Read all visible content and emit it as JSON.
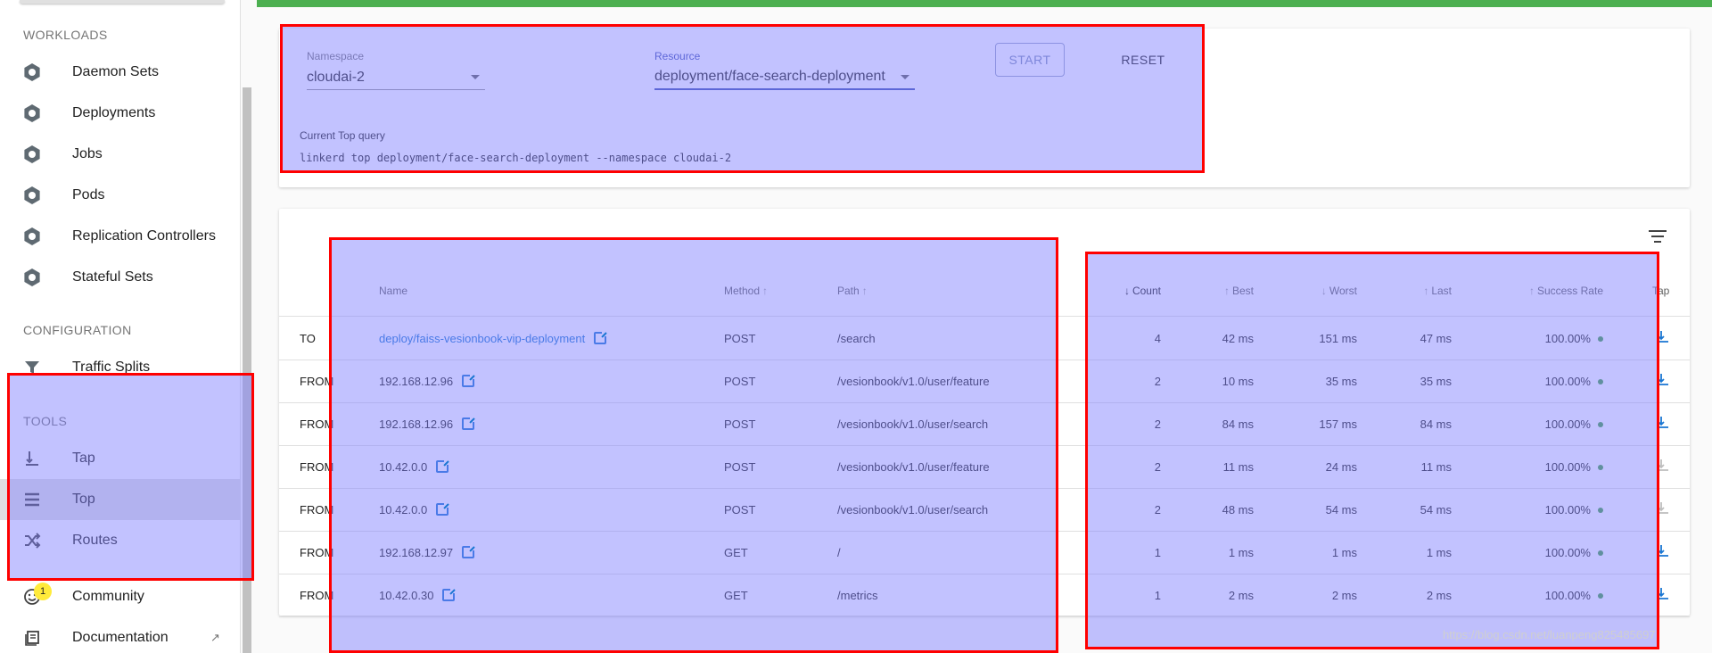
{
  "sidebar": {
    "workloads_label": "WORKLOADS",
    "workloads": [
      {
        "label": "Daemon Sets",
        "icon": "daemon-sets-icon"
      },
      {
        "label": "Deployments",
        "icon": "deployments-icon"
      },
      {
        "label": "Jobs",
        "icon": "jobs-icon"
      },
      {
        "label": "Pods",
        "icon": "pods-icon"
      },
      {
        "label": "Replication Controllers",
        "icon": "replication-controllers-icon"
      },
      {
        "label": "Stateful Sets",
        "icon": "stateful-sets-icon"
      }
    ],
    "configuration_label": "CONFIGURATION",
    "configuration": [
      {
        "label": "Traffic Splits",
        "icon": "funnel-icon"
      }
    ],
    "tools_label": "TOOLS",
    "tools": [
      {
        "label": "Tap",
        "icon": "tap-icon"
      },
      {
        "label": "Top",
        "icon": "list-icon",
        "active": true
      },
      {
        "label": "Routes",
        "icon": "shuffle-icon"
      }
    ],
    "community": {
      "label": "Community",
      "badge": "1",
      "icon": "smiley-icon"
    },
    "documentation": {
      "label": "Documentation",
      "icon": "book-icon"
    }
  },
  "query": {
    "namespace_label": "Namespace",
    "namespace_value": "cloudai-2",
    "resource_label": "Resource",
    "resource_value": "deployment/face-search-deployment",
    "start_label": "START",
    "reset_label": "RESET",
    "current_label": "Current Top query",
    "current_text": "linkerd top deployment/face-search-deployment --namespace cloudai-2"
  },
  "table": {
    "headers": {
      "name": "Name",
      "method": "Method",
      "path": "Path",
      "count": "Count",
      "best": "Best",
      "worst": "Worst",
      "last": "Last",
      "success": "Success Rate",
      "tap": "Tap"
    },
    "rows": [
      {
        "dir": "TO",
        "name": "deploy/faiss-vesionbook-vip-deployment",
        "link": true,
        "method": "POST",
        "path": "/search",
        "count": "4",
        "best": "42 ms",
        "worst": "151 ms",
        "last": "47 ms",
        "success": "100.00%",
        "tap_enabled": true
      },
      {
        "dir": "FROM",
        "name": "192.168.12.96",
        "link": false,
        "method": "POST",
        "path": "/vesionbook/v1.0/user/feature",
        "count": "2",
        "best": "10 ms",
        "worst": "35 ms",
        "last": "35 ms",
        "success": "100.00%",
        "tap_enabled": true
      },
      {
        "dir": "FROM",
        "name": "192.168.12.96",
        "link": false,
        "method": "POST",
        "path": "/vesionbook/v1.0/user/search",
        "count": "2",
        "best": "84 ms",
        "worst": "157 ms",
        "last": "84 ms",
        "success": "100.00%",
        "tap_enabled": true
      },
      {
        "dir": "FROM",
        "name": "10.42.0.0",
        "link": false,
        "method": "POST",
        "path": "/vesionbook/v1.0/user/feature",
        "count": "2",
        "best": "11 ms",
        "worst": "24 ms",
        "last": "11 ms",
        "success": "100.00%",
        "tap_enabled": false
      },
      {
        "dir": "FROM",
        "name": "10.42.0.0",
        "link": false,
        "method": "POST",
        "path": "/vesionbook/v1.0/user/search",
        "count": "2",
        "best": "48 ms",
        "worst": "54 ms",
        "last": "54 ms",
        "success": "100.00%",
        "tap_enabled": false
      },
      {
        "dir": "FROM",
        "name": "192.168.12.97",
        "link": false,
        "method": "GET",
        "path": "/",
        "count": "1",
        "best": "1 ms",
        "worst": "1 ms",
        "last": "1 ms",
        "success": "100.00%",
        "tap_enabled": true
      },
      {
        "dir": "FROM",
        "name": "10.42.0.30",
        "link": false,
        "method": "GET",
        "path": "/metrics",
        "count": "1",
        "best": "2 ms",
        "worst": "2 ms",
        "last": "2 ms",
        "success": "100.00%",
        "tap_enabled": true
      }
    ]
  },
  "watermark": "https://blog.csdn.net/luanpeng825485697",
  "colors": {
    "green_bar": "#4caf50",
    "link": "#1976d2",
    "success_dot": "#43a047",
    "highlight_fill": "#8080ff",
    "highlight_border": "#ff0000"
  }
}
